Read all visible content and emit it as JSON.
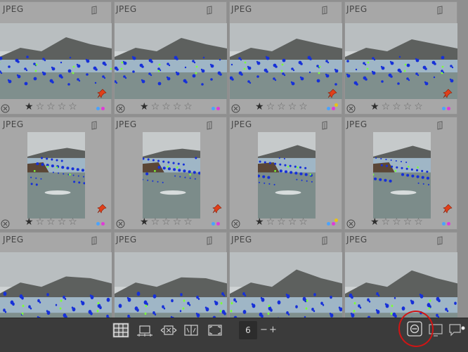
{
  "thumbnails": [
    {
      "format": "JPEG",
      "rating": 1,
      "pinned": true,
      "label_colors": [
        "#4aa3ff",
        "#e03ad8"
      ],
      "extra_dot": false
    },
    {
      "format": "JPEG",
      "rating": 1,
      "pinned": false,
      "label_colors": [
        "#4aa3ff",
        "#e03ad8"
      ],
      "extra_dot": false
    },
    {
      "format": "JPEG",
      "rating": 1,
      "pinned": true,
      "label_colors": [
        "#4aa3ff",
        "#e03ad8"
      ],
      "extra_dot": true
    },
    {
      "format": "JPEG",
      "rating": 1,
      "pinned": true,
      "label_colors": [
        "#4aa3ff",
        "#e03ad8"
      ],
      "extra_dot": false
    },
    {
      "format": "JPEG",
      "rating": 1,
      "pinned": true,
      "label_colors": [
        "#4aa3ff",
        "#e03ad8"
      ],
      "extra_dot": false
    },
    {
      "format": "JPEG",
      "rating": 1,
      "pinned": true,
      "label_colors": [
        "#4aa3ff",
        "#e03ad8"
      ],
      "extra_dot": false
    },
    {
      "format": "JPEG",
      "rating": 1,
      "pinned": false,
      "label_colors": [
        "#4aa3ff",
        "#e03ad8"
      ],
      "extra_dot": true
    },
    {
      "format": "JPEG",
      "rating": 1,
      "pinned": true,
      "label_colors": [
        "#4aa3ff",
        "#e03ad8"
      ],
      "extra_dot": false
    },
    {
      "format": "JPEG",
      "rating": 0,
      "pinned": false,
      "label_colors": [],
      "extra_dot": false
    },
    {
      "format": "JPEG",
      "rating": 0,
      "pinned": false,
      "label_colors": [],
      "extra_dot": false
    },
    {
      "format": "JPEG",
      "rating": 0,
      "pinned": false,
      "label_colors": [],
      "extra_dot": false
    },
    {
      "format": "JPEG",
      "rating": 0,
      "pinned": false,
      "label_colors": [],
      "extra_dot": false
    }
  ],
  "toolbar": {
    "zoom_value": "6",
    "zoom_minus": "−",
    "zoom_plus": "+",
    "buttons": [
      {
        "icon": "filemanager-layout-icon",
        "active": true
      },
      {
        "icon": "filmstrip-layout-icon",
        "active": false
      },
      {
        "icon": "zoomable-layout-icon",
        "active": false
      },
      {
        "icon": "culling-layout-icon",
        "active": false
      },
      {
        "icon": "preview-layout-icon",
        "active": false
      }
    ],
    "right_icons": [
      "overlays-icon",
      "display-icon",
      "comments-icon"
    ]
  },
  "colors": {
    "accent_annotation": "#d11414",
    "pin": "#e0401a",
    "toolbar_bg": "#3b3b3b",
    "grid_bg": "#8f8f8f"
  }
}
